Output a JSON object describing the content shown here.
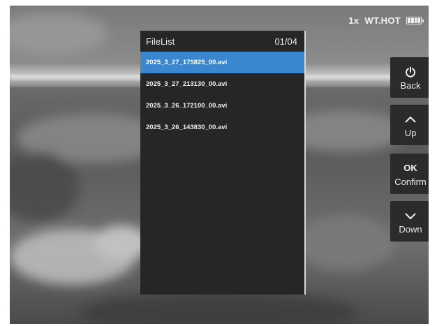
{
  "status": {
    "zoom": "1x",
    "palette": "WT.HOT",
    "battery_icon": "battery-full-icon"
  },
  "filelist": {
    "title": "FileList",
    "page": "01/04",
    "items": [
      {
        "name": "2025_3_27_175825_00.avi",
        "selected": true
      },
      {
        "name": "2025_3_27_213130_00.avi",
        "selected": false
      },
      {
        "name": "2025_3_26_172100_00.avi",
        "selected": false
      },
      {
        "name": "2025_3_26_143830_00.avi",
        "selected": false
      }
    ]
  },
  "buttons": {
    "back": {
      "icon": "power-icon",
      "label": "Back"
    },
    "up": {
      "icon": "chevron-up-icon",
      "label": "Up"
    },
    "confirm": {
      "icon_text": "OK",
      "label": "Confirm"
    },
    "down": {
      "icon": "chevron-down-icon",
      "label": "Down"
    }
  },
  "colors": {
    "selection": "#3a86cf",
    "panel": "#262626",
    "button": "#2b2b2b"
  }
}
